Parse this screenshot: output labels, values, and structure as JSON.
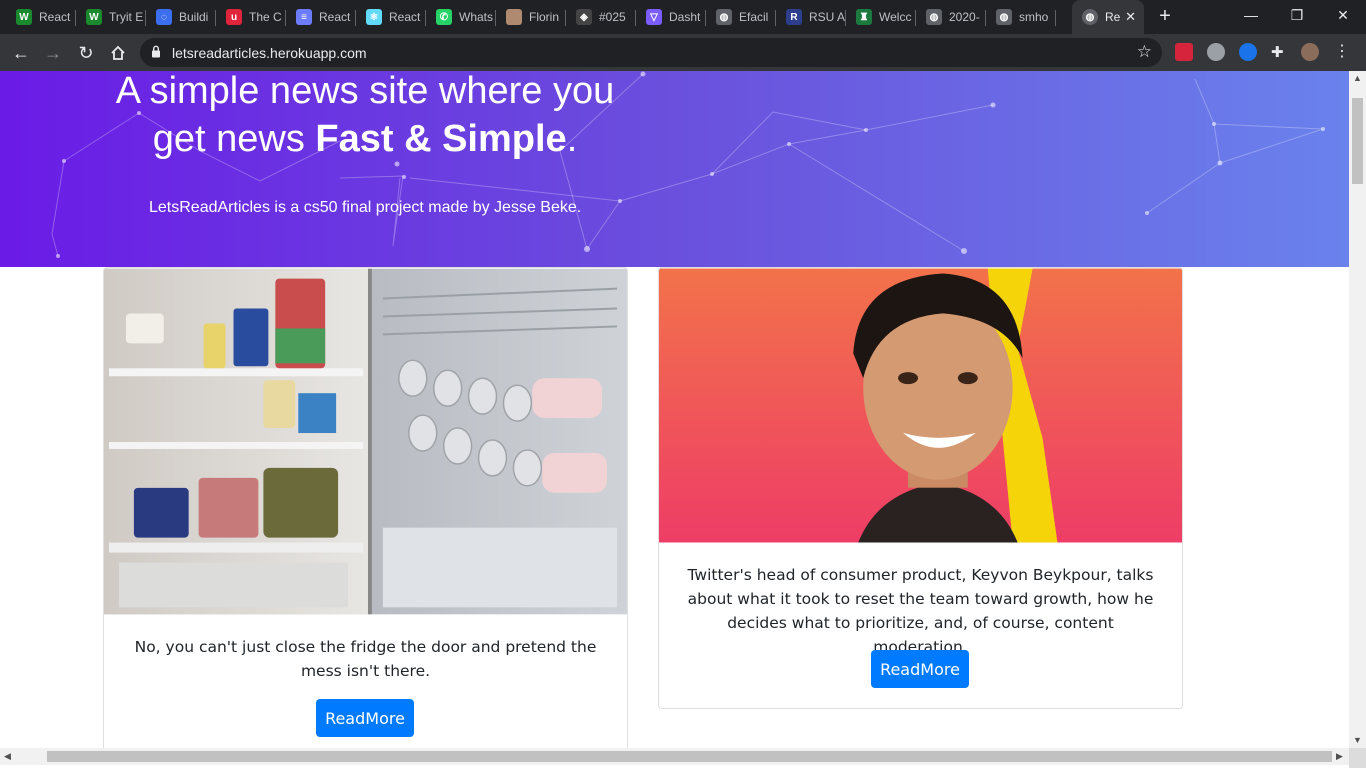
{
  "browser": {
    "tabs": [
      {
        "title": "React",
        "color": "#1b8a2e",
        "glyph": "W"
      },
      {
        "title": "Tryit E",
        "color": "#1b8a2e",
        "glyph": "W"
      },
      {
        "title": "Buildi",
        "color": "#3c6ef0",
        "glyph": "◌"
      },
      {
        "title": "The C",
        "color": "#e0243b",
        "glyph": "u"
      },
      {
        "title": "React",
        "color": "#6b7cff",
        "glyph": "≡"
      },
      {
        "title": "React",
        "color": "#61dafb",
        "glyph": "⚛"
      },
      {
        "title": "Whats",
        "color": "#25d366",
        "glyph": "✆"
      },
      {
        "title": "Florin",
        "color": "#b08a70",
        "glyph": ""
      },
      {
        "title": "#025",
        "color": "#444444",
        "glyph": "◈"
      },
      {
        "title": "Dasht",
        "color": "#7b5cff",
        "glyph": "▽"
      },
      {
        "title": "Efacil",
        "color": "#5f6368",
        "glyph": "◍"
      },
      {
        "title": "RSU A",
        "color": "#2c3e8c",
        "glyph": "R"
      },
      {
        "title": "Welcc",
        "color": "#1d7a3e",
        "glyph": "♜"
      },
      {
        "title": "2020-",
        "color": "#5f6368",
        "glyph": "◍"
      },
      {
        "title": "smho",
        "color": "#5f6368",
        "glyph": "◍"
      }
    ],
    "active_tab": {
      "title": "Re",
      "glyph": "◍"
    },
    "url": "letsreadarticles.herokuapp.com"
  },
  "hero": {
    "title_line1": "A simple news site where you",
    "title_line2_prefix": "get news ",
    "title_line2_bold": "Fast & Simple",
    "title_line2_suffix": ".",
    "subtitle": "LetsReadArticles is a cs50 final project made by Jesse Beke."
  },
  "articles": [
    {
      "summary": "No, you can't just close the fridge the door and pretend the mess isn't there.",
      "button": "ReadMore",
      "image": "fridge-photo"
    },
    {
      "summary": "Twitter's head of consumer product, Keyvon Beykpour, talks about what it took to reset the team toward growth, how he decides what to prioritize, and, of course, content moderation.",
      "button": "ReadMore",
      "image": "portrait-photo"
    }
  ],
  "colors": {
    "primary_button": "#007bff",
    "hero_gradient_start": "#6a1be6",
    "hero_gradient_end": "#6a82ec"
  }
}
